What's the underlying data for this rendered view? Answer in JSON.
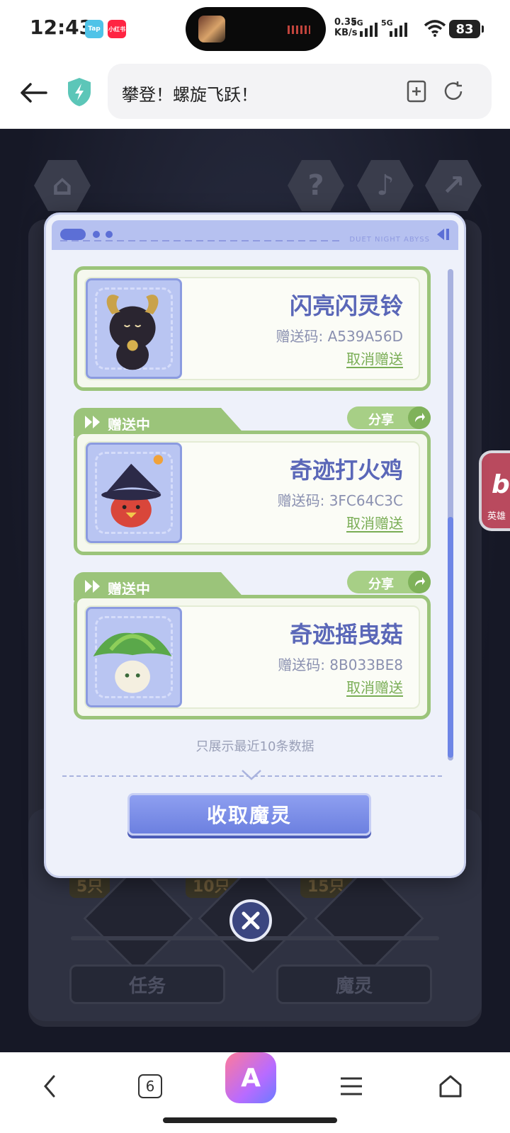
{
  "status_bar": {
    "time": "12:43",
    "badges": [
      {
        "label": "Tap",
        "color": "#4fc3e8"
      },
      {
        "label": "小红书",
        "color": "#ff2442"
      }
    ],
    "net_speed": "0.35",
    "net_unit": "KB/s",
    "sim1": "5G",
    "sim2": "5G",
    "battery": "83"
  },
  "browser": {
    "url_title": "攀登！螺旋飞跃！",
    "icons": [
      "back-arrow-icon",
      "shield-icon",
      "bookmark-add-icon",
      "reload-icon"
    ]
  },
  "modal": {
    "header_brand": "DUET NIGHT ABYSS",
    "items": [
      {
        "name": "闪亮闪灵铃",
        "code": "赠送码: A539A56D",
        "cancel": "取消赠送",
        "status": "",
        "share": ""
      },
      {
        "name": "奇迹打火鸡",
        "code": "赠送码: 3FC64C3C",
        "cancel": "取消赠送",
        "status": "赠送中",
        "share": "分享"
      },
      {
        "name": "奇迹摇曳菇",
        "code": "赠送码: 8B033BE8",
        "cancel": "取消赠送",
        "status": "赠送中",
        "share": "分享"
      }
    ],
    "footnote": "只展示最近10条数据",
    "collect_button": "收取魔灵"
  },
  "background": {
    "tags": [
      "5只",
      "10只",
      "15只"
    ],
    "task_button": "任务",
    "spirit_button": "魔灵",
    "side_badge": "bi",
    "side_badge_sub": "英雄"
  },
  "bottom_nav": {
    "tab_count": "6",
    "ai_label": "A"
  },
  "colors": {
    "accent_blue": "#6c80e0",
    "accent_green": "#9bc47a",
    "title_purple": "#5a67b8"
  }
}
